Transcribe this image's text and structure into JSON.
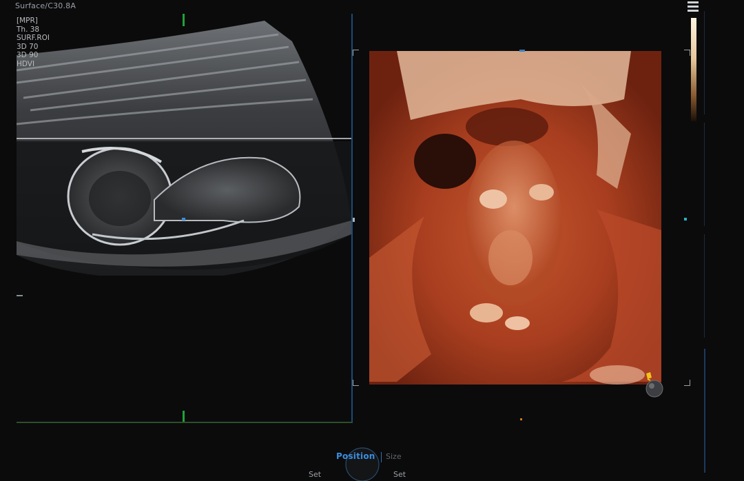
{
  "header": {
    "mode_label": "Surface/C30.8A"
  },
  "info_list": [
    "[MPR]",
    "Th. 38",
    "SURF.ROI",
    "3D 70",
    "3D 90",
    "HDVI"
  ],
  "side_panel": {
    "columns": [
      "",
      "",
      "",
      ""
    ]
  },
  "bottom_controls": {
    "active_tab": "Position",
    "other_tab": "Size",
    "left_action": "Set",
    "right_action": "Set"
  },
  "icons": {
    "light_source": "light-source-icon",
    "knob": "trackball-knob-icon",
    "top_right": "menu-icon"
  },
  "colors": {
    "accent_blue": "#3a8ee0",
    "marker_green": "#1fa33a",
    "render_tone": "#b4482a"
  }
}
